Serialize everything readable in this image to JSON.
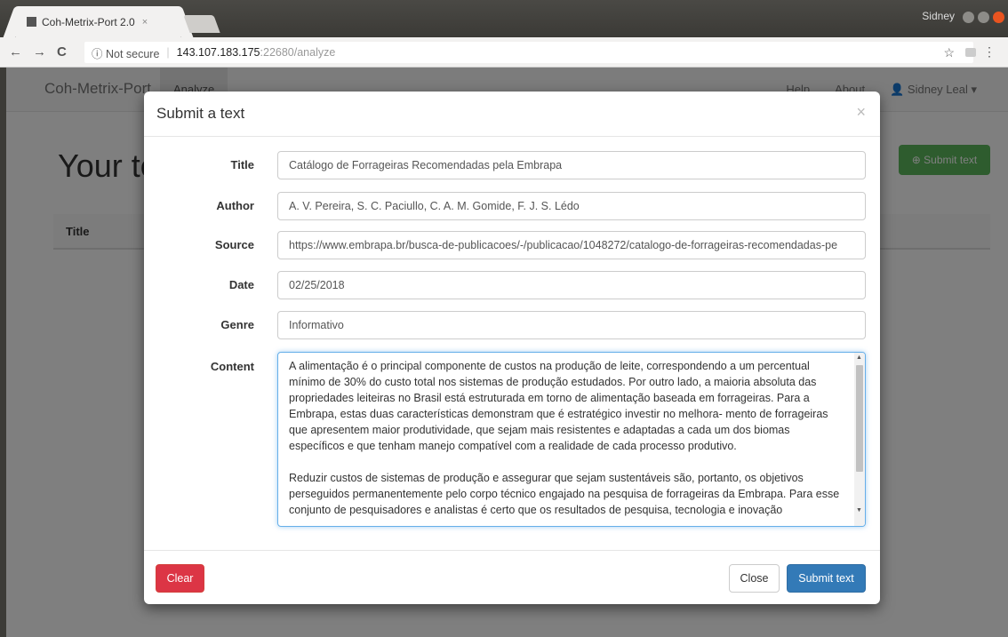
{
  "browser": {
    "tab_title": "Coh-Metrix-Port 2.0",
    "tab_close": "×",
    "profile_name": "Sidney",
    "security_label": "ⓘ Not secure",
    "url_host": "143.107.183.175",
    "url_path": ":22680/analyze",
    "back": "←",
    "forward": "→",
    "reload": "C",
    "star": "☆",
    "menu": "⋮"
  },
  "app": {
    "brand": "Coh-Metrix-Port",
    "nav_analyze": "Analyze",
    "nav_help": "Help",
    "nav_about": "About",
    "user_menu": "Sidney Leal ▾",
    "page_heading": "Your te",
    "submit_button_bg": "Submit text",
    "table_col_title": "Title"
  },
  "modal": {
    "title": "Submit a text",
    "close_x": "×",
    "fields": {
      "title_label": "Title",
      "title_value": "Catálogo de Forrageiras Recomendadas pela Embrapa",
      "author_label": "Author",
      "author_value": "A. V. Pereira, S. C. Paciullo, C. A. M. Gomide, F. J. S. Lédo",
      "source_label": "Source",
      "source_value": "https://www.embrapa.br/busca-de-publicacoes/-/publicacao/1048272/catalogo-de-forrageiras-recomendadas-pe",
      "date_label": "Date",
      "date_value": "02/25/2018",
      "genre_label": "Genre",
      "genre_value": "Informativo",
      "content_label": "Content",
      "content_value": "A alimentação é o principal componente de custos na produção de leite, correspondendo a um percentual mínimo de 30% do custo total nos sistemas de produção estudados. Por outro lado, a maioria absoluta das propriedades leiteiras no Brasil está estruturada em torno de alimentação baseada em forrageiras. Para a Embrapa, estas duas características demonstram que é estratégico investir no melhora- mento de forrageiras que apresentem maior produtividade, que sejam mais resistentes e adaptadas a cada um dos biomas específicos e que tenham manejo compatível com a realidade de cada processo produtivo.\n\nReduzir custos de sistemas de produção e assegurar que sejam sustentáveis são, portanto, os objetivos perseguidos permanentemente pelo corpo técnico engajado na pesquisa de forrageiras da Embrapa. Para esse conjunto de pesquisadores e analistas é certo que os resultados de pesquisa, tecnologia e inovação"
    },
    "buttons": {
      "clear": "Clear",
      "close": "Close",
      "submit": "Submit text"
    }
  }
}
